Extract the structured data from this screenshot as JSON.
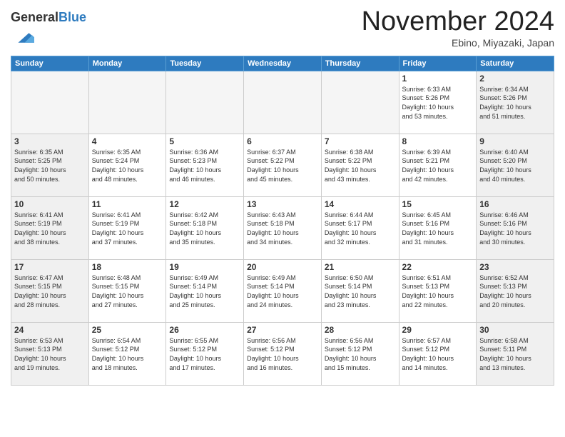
{
  "header": {
    "logo_line1": "General",
    "logo_line2": "Blue",
    "month": "November 2024",
    "location": "Ebino, Miyazaki, Japan"
  },
  "weekdays": [
    "Sunday",
    "Monday",
    "Tuesday",
    "Wednesday",
    "Thursday",
    "Friday",
    "Saturday"
  ],
  "weeks": [
    [
      {
        "day": "",
        "info": ""
      },
      {
        "day": "",
        "info": ""
      },
      {
        "day": "",
        "info": ""
      },
      {
        "day": "",
        "info": ""
      },
      {
        "day": "",
        "info": ""
      },
      {
        "day": "1",
        "info": "Sunrise: 6:33 AM\nSunset: 5:26 PM\nDaylight: 10 hours\nand 53 minutes."
      },
      {
        "day": "2",
        "info": "Sunrise: 6:34 AM\nSunset: 5:26 PM\nDaylight: 10 hours\nand 51 minutes."
      }
    ],
    [
      {
        "day": "3",
        "info": "Sunrise: 6:35 AM\nSunset: 5:25 PM\nDaylight: 10 hours\nand 50 minutes."
      },
      {
        "day": "4",
        "info": "Sunrise: 6:35 AM\nSunset: 5:24 PM\nDaylight: 10 hours\nand 48 minutes."
      },
      {
        "day": "5",
        "info": "Sunrise: 6:36 AM\nSunset: 5:23 PM\nDaylight: 10 hours\nand 46 minutes."
      },
      {
        "day": "6",
        "info": "Sunrise: 6:37 AM\nSunset: 5:22 PM\nDaylight: 10 hours\nand 45 minutes."
      },
      {
        "day": "7",
        "info": "Sunrise: 6:38 AM\nSunset: 5:22 PM\nDaylight: 10 hours\nand 43 minutes."
      },
      {
        "day": "8",
        "info": "Sunrise: 6:39 AM\nSunset: 5:21 PM\nDaylight: 10 hours\nand 42 minutes."
      },
      {
        "day": "9",
        "info": "Sunrise: 6:40 AM\nSunset: 5:20 PM\nDaylight: 10 hours\nand 40 minutes."
      }
    ],
    [
      {
        "day": "10",
        "info": "Sunrise: 6:41 AM\nSunset: 5:19 PM\nDaylight: 10 hours\nand 38 minutes."
      },
      {
        "day": "11",
        "info": "Sunrise: 6:41 AM\nSunset: 5:19 PM\nDaylight: 10 hours\nand 37 minutes."
      },
      {
        "day": "12",
        "info": "Sunrise: 6:42 AM\nSunset: 5:18 PM\nDaylight: 10 hours\nand 35 minutes."
      },
      {
        "day": "13",
        "info": "Sunrise: 6:43 AM\nSunset: 5:18 PM\nDaylight: 10 hours\nand 34 minutes."
      },
      {
        "day": "14",
        "info": "Sunrise: 6:44 AM\nSunset: 5:17 PM\nDaylight: 10 hours\nand 32 minutes."
      },
      {
        "day": "15",
        "info": "Sunrise: 6:45 AM\nSunset: 5:16 PM\nDaylight: 10 hours\nand 31 minutes."
      },
      {
        "day": "16",
        "info": "Sunrise: 6:46 AM\nSunset: 5:16 PM\nDaylight: 10 hours\nand 30 minutes."
      }
    ],
    [
      {
        "day": "17",
        "info": "Sunrise: 6:47 AM\nSunset: 5:15 PM\nDaylight: 10 hours\nand 28 minutes."
      },
      {
        "day": "18",
        "info": "Sunrise: 6:48 AM\nSunset: 5:15 PM\nDaylight: 10 hours\nand 27 minutes."
      },
      {
        "day": "19",
        "info": "Sunrise: 6:49 AM\nSunset: 5:14 PM\nDaylight: 10 hours\nand 25 minutes."
      },
      {
        "day": "20",
        "info": "Sunrise: 6:49 AM\nSunset: 5:14 PM\nDaylight: 10 hours\nand 24 minutes."
      },
      {
        "day": "21",
        "info": "Sunrise: 6:50 AM\nSunset: 5:14 PM\nDaylight: 10 hours\nand 23 minutes."
      },
      {
        "day": "22",
        "info": "Sunrise: 6:51 AM\nSunset: 5:13 PM\nDaylight: 10 hours\nand 22 minutes."
      },
      {
        "day": "23",
        "info": "Sunrise: 6:52 AM\nSunset: 5:13 PM\nDaylight: 10 hours\nand 20 minutes."
      }
    ],
    [
      {
        "day": "24",
        "info": "Sunrise: 6:53 AM\nSunset: 5:13 PM\nDaylight: 10 hours\nand 19 minutes."
      },
      {
        "day": "25",
        "info": "Sunrise: 6:54 AM\nSunset: 5:12 PM\nDaylight: 10 hours\nand 18 minutes."
      },
      {
        "day": "26",
        "info": "Sunrise: 6:55 AM\nSunset: 5:12 PM\nDaylight: 10 hours\nand 17 minutes."
      },
      {
        "day": "27",
        "info": "Sunrise: 6:56 AM\nSunset: 5:12 PM\nDaylight: 10 hours\nand 16 minutes."
      },
      {
        "day": "28",
        "info": "Sunrise: 6:56 AM\nSunset: 5:12 PM\nDaylight: 10 hours\nand 15 minutes."
      },
      {
        "day": "29",
        "info": "Sunrise: 6:57 AM\nSunset: 5:12 PM\nDaylight: 10 hours\nand 14 minutes."
      },
      {
        "day": "30",
        "info": "Sunrise: 6:58 AM\nSunset: 5:11 PM\nDaylight: 10 hours\nand 13 minutes."
      }
    ]
  ]
}
